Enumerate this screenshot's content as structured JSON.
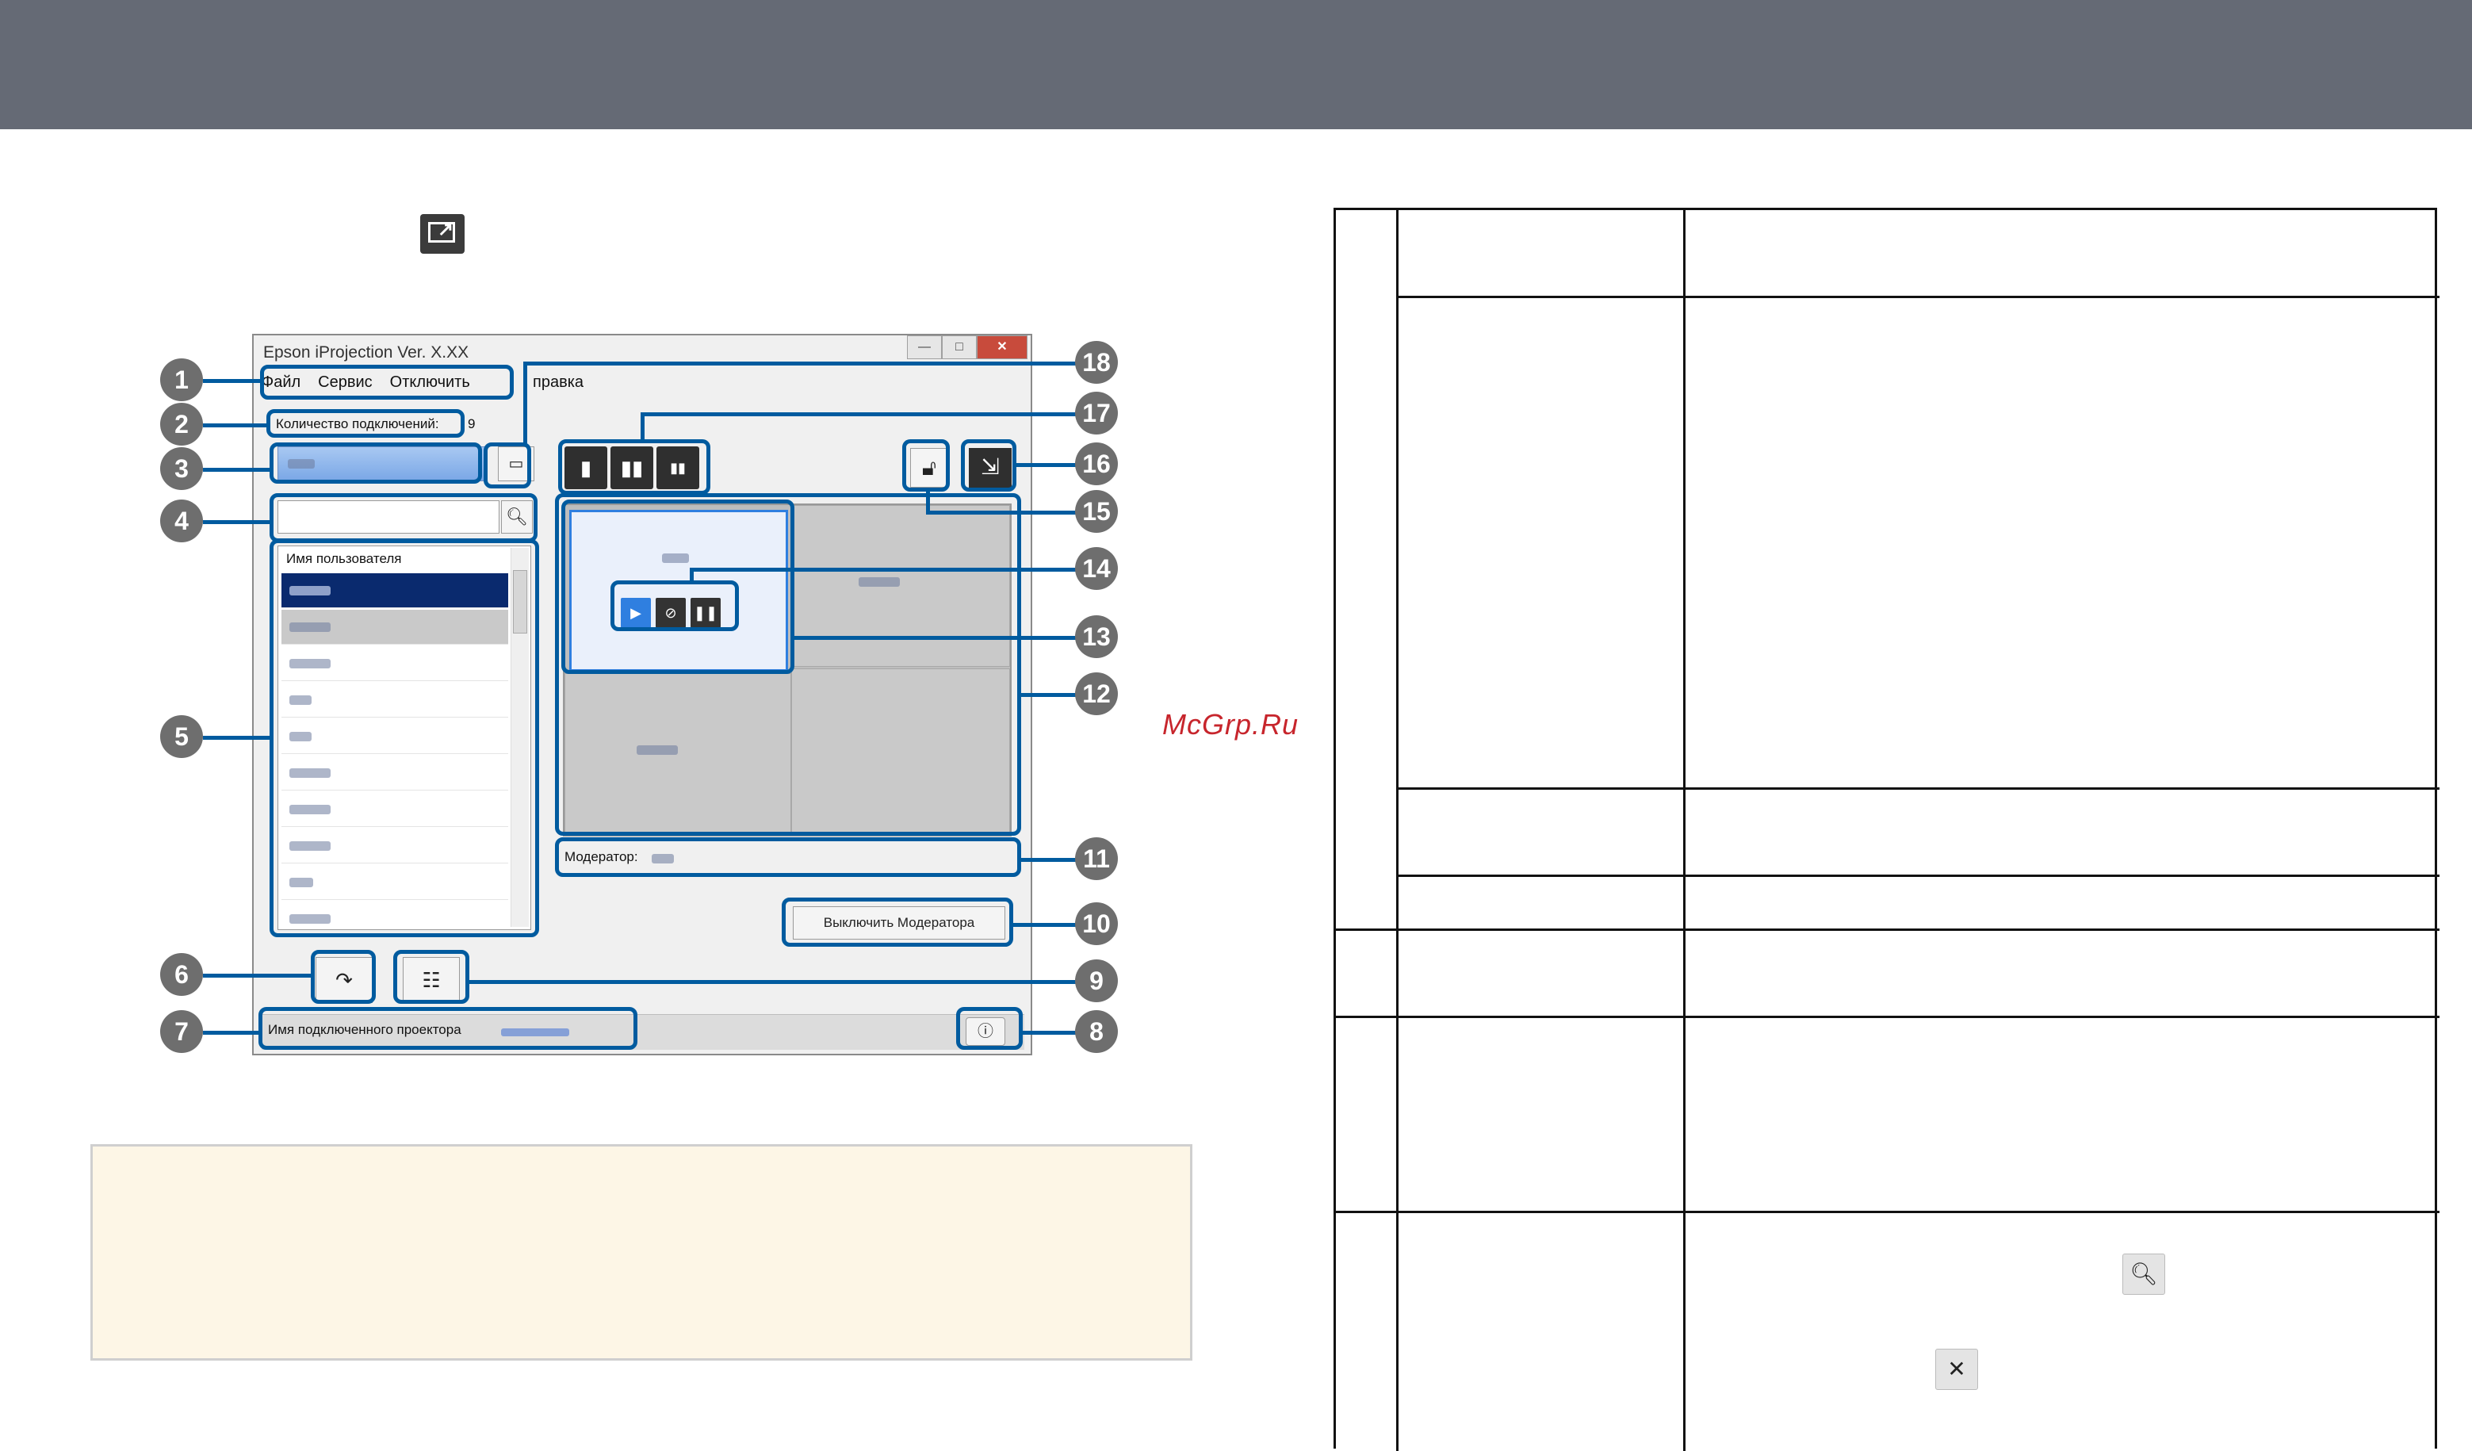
{
  "window": {
    "title": "Epson iProjection Ver. X.XX",
    "buttons": [
      "—",
      "□",
      "✕"
    ]
  },
  "menu": {
    "items": [
      "Файл",
      "Сервис",
      "Отключить"
    ],
    "extra": "правка"
  },
  "connection": {
    "label": "Количество подключений:",
    "count": "9"
  },
  "user_list": {
    "header": "Имя пользователя",
    "row_count": 10
  },
  "grid": {
    "cells": 4
  },
  "moderator": {
    "label": "Модератор:"
  },
  "buttons": {
    "moderator_off": "Выключить Модератора"
  },
  "status": {
    "projector_label": "Имя подключенного проектора"
  },
  "callouts": [
    "1",
    "2",
    "3",
    "4",
    "5",
    "6",
    "7",
    "8",
    "9",
    "10",
    "11",
    "12",
    "13",
    "14",
    "15",
    "16",
    "17",
    "18"
  ],
  "watermark": "McGrp.Ru",
  "colors": {
    "callout_outline": "#005b9f",
    "callout_badge": "#6e6e6e",
    "header_bar": "#656a75",
    "selection": "#2f7fe0",
    "note_bg": "#fdf6e6"
  },
  "icons": {
    "search": "magnifier",
    "clear_search": "magnifier-with-cross",
    "projector_window": "expand-window"
  }
}
